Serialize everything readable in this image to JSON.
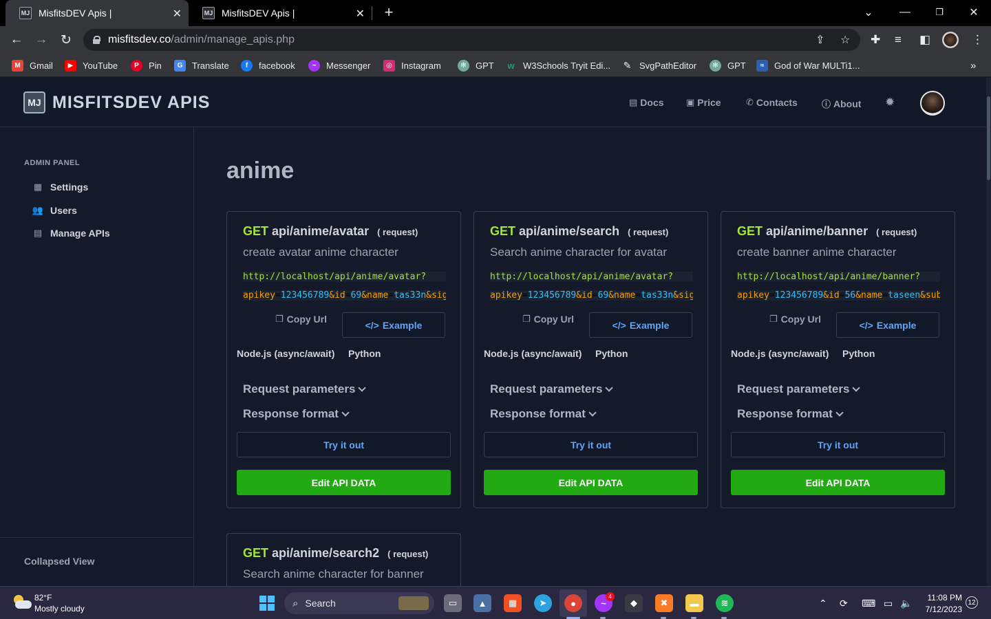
{
  "browser": {
    "tabs": [
      {
        "title": "MisfitsDEV Apis |",
        "active": true
      },
      {
        "title": "MisfitsDEV Apis |",
        "active": false
      }
    ],
    "url_host": "misfitsdev.co",
    "url_path": "/admin/manage_apis.php",
    "bookmarks": [
      {
        "label": "Gmail",
        "icon": "gmail-icon",
        "color": "#ea4335"
      },
      {
        "label": "YouTube",
        "icon": "youtube-icon",
        "color": "#ff0000"
      },
      {
        "label": "Pin",
        "icon": "pinterest-icon",
        "color": "#e60023"
      },
      {
        "label": "Translate",
        "icon": "translate-icon",
        "color": "#4285f4"
      },
      {
        "label": "facebook",
        "icon": "facebook-icon",
        "color": "#1877f2"
      },
      {
        "label": "Messenger",
        "icon": "messenger-icon",
        "color": "#a334fa"
      },
      {
        "label": "Instagram",
        "icon": "instagram-icon",
        "color": "#d62976"
      },
      {
        "label": "GPT",
        "icon": "chatgpt-icon",
        "color": "#74aa9c"
      },
      {
        "label": "W3Schools Tryit Edi...",
        "icon": "w3schools-icon",
        "color": "#04aa6d"
      },
      {
        "label": "SvgPathEditor",
        "icon": "svg-path-icon",
        "color": "#222222"
      },
      {
        "label": "GPT",
        "icon": "chatgpt-icon",
        "color": "#74aa9c"
      },
      {
        "label": "God of War MULTi1...",
        "icon": "game-icon",
        "color": "#2b5fb4"
      }
    ]
  },
  "site": {
    "logo_text": "MISFITSDEV APIS",
    "logo_mark": "MJ",
    "nav": [
      {
        "label": "Docs",
        "icon": "book-icon"
      },
      {
        "label": "Price",
        "icon": "money-icon"
      },
      {
        "label": "Contacts",
        "icon": "phone-icon"
      },
      {
        "label": "About",
        "icon": "info-icon"
      }
    ]
  },
  "sidebar": {
    "title": "ADMIN PANEL",
    "items": [
      {
        "label": "Settings",
        "icon": "settings-grid-icon"
      },
      {
        "label": "Users",
        "icon": "users-icon"
      },
      {
        "label": "Manage APIs",
        "icon": "list-icon"
      }
    ],
    "footer": "Collapsed View"
  },
  "main": {
    "title": "anime",
    "cards": [
      {
        "method": "GET",
        "endpoint": "api/anime/avatar",
        "tag": "( request)",
        "description": "create avatar anime character",
        "url_base": "http://localhost/api/anime/avatar?",
        "params": [
          {
            "key": "apikey",
            "value": "123456789"
          },
          {
            "key": "id",
            "value": "69"
          },
          {
            "key": "name",
            "value": "tas33n"
          },
          {
            "key": "sig",
            "value": ""
          }
        ],
        "copy_label": "Copy Url",
        "example_label": "Example",
        "languages": [
          "Node.js (async/await)",
          "Python"
        ],
        "request_params_label": "Request parameters",
        "response_format_label": "Response format",
        "try_label": "Try it out",
        "edit_label": "Edit API DATA"
      },
      {
        "method": "GET",
        "endpoint": "api/anime/search",
        "tag": "( request)",
        "description": "Search anime character for avatar",
        "url_base": "http://localhost/api/anime/avatar?",
        "params": [
          {
            "key": "apikey",
            "value": "123456789"
          },
          {
            "key": "id",
            "value": "69"
          },
          {
            "key": "name",
            "value": "tas33n"
          },
          {
            "key": "sig",
            "value": ""
          }
        ],
        "copy_label": "Copy Url",
        "example_label": "Example",
        "languages": [
          "Node.js (async/await)",
          "Python"
        ],
        "request_params_label": "Request parameters",
        "response_format_label": "Response format",
        "try_label": "Try it out",
        "edit_label": "Edit API DATA"
      },
      {
        "method": "GET",
        "endpoint": "api/anime/banner",
        "tag": "( request)",
        "description": "create banner anime character",
        "url_base": "http://localhost/api/anime/banner?",
        "params": [
          {
            "key": "apikey",
            "value": "123456789"
          },
          {
            "key": "id",
            "value": "56"
          },
          {
            "key": "name",
            "value": "taseen"
          },
          {
            "key": "sub",
            "value": ""
          }
        ],
        "copy_label": "Copy Url",
        "example_label": "Example",
        "languages": [
          "Node.js (async/await)",
          "Python"
        ],
        "request_params_label": "Request parameters",
        "response_format_label": "Response format",
        "try_label": "Try it out",
        "edit_label": "Edit API DATA"
      },
      {
        "method": "GET",
        "endpoint": "api/anime/search2",
        "tag": "( request)",
        "description": "Search anime character for banner"
      }
    ]
  },
  "taskbar": {
    "weather_temp": "82°F",
    "weather_desc": "Mostly cloudy",
    "search_placeholder": "Search",
    "messenger_badge": "4",
    "time": "11:08 PM",
    "date": "7/12/2023",
    "notifications": "12"
  },
  "colors": {
    "accent_green": "#22aa12",
    "method_green": "#a3e635",
    "link_blue": "#60a5fa",
    "bg": "#151a2b"
  }
}
